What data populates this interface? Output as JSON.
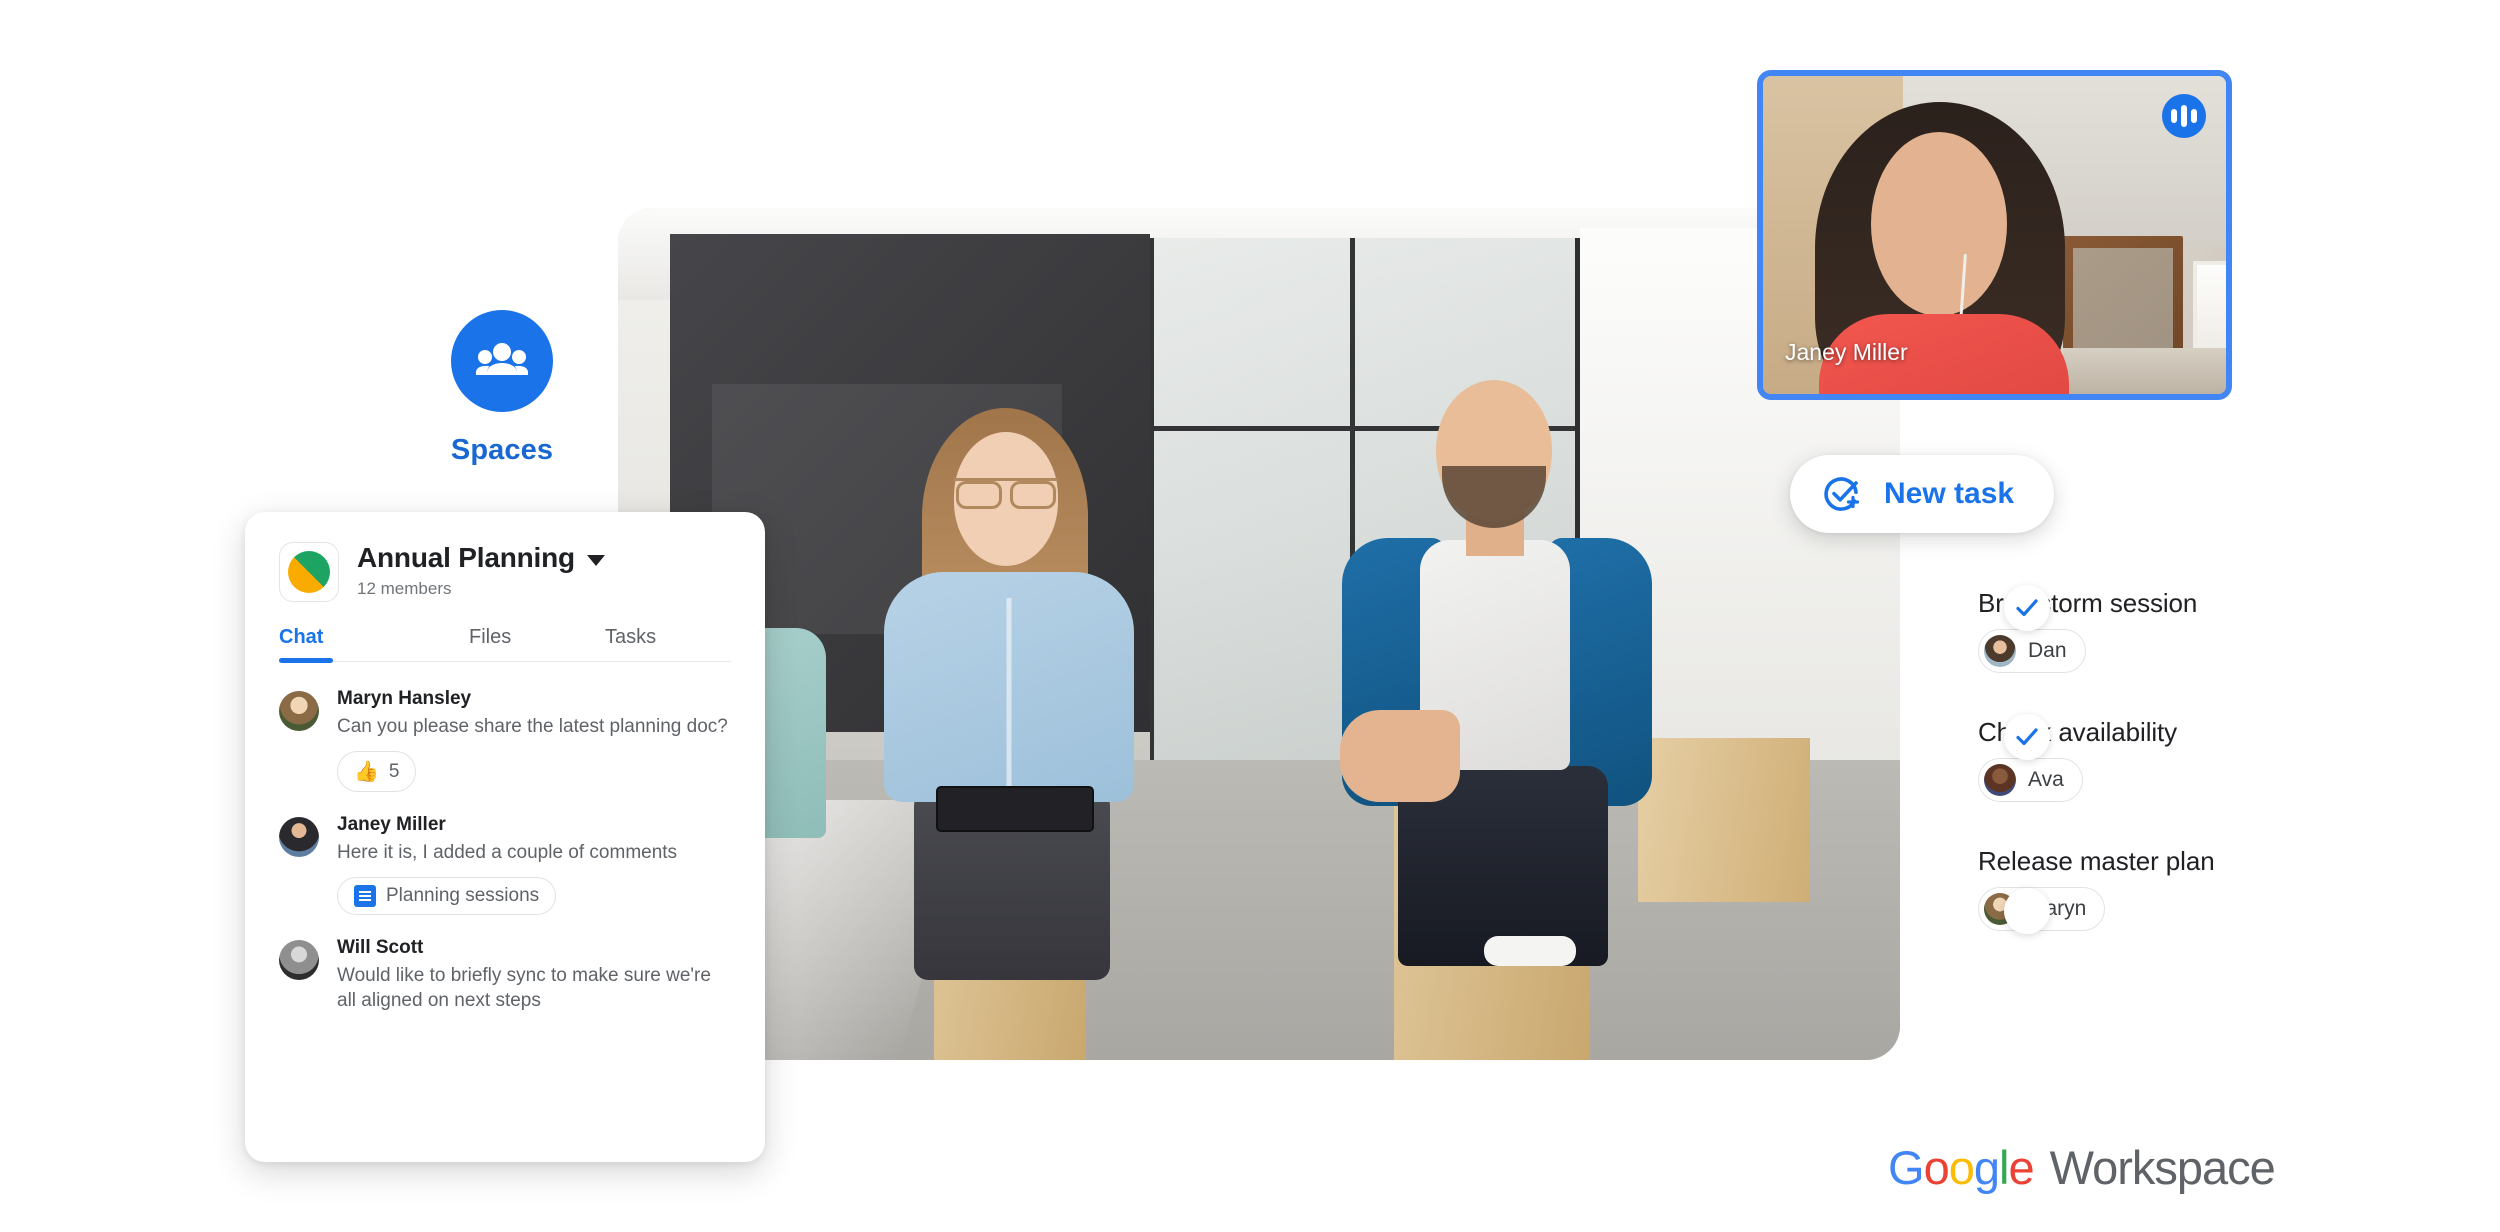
{
  "spaces_nav": {
    "label": "Spaces",
    "icon": "people-group-icon",
    "accent": "#1A73E8",
    "label_color": "#1967D2"
  },
  "chat_card": {
    "space_name": "Annual Planning",
    "members": "12 members",
    "avatar_icon": "space-avatar-green-yellow",
    "avatar_colors": {
      "green": "#1DA462",
      "yellow": "#F9AB00"
    },
    "dropdown_icon": "chevron-down-icon",
    "tabs": [
      {
        "label": "Chat",
        "active": true
      },
      {
        "label": "Files",
        "active": false
      },
      {
        "label": "Tasks",
        "active": false
      }
    ],
    "active_tab_color": "#1A73E8",
    "messages": [
      {
        "author": "Maryn Hansley",
        "text": "Can you please share the latest planning doc?",
        "reaction": {
          "emoji": "👍",
          "count": "5"
        }
      },
      {
        "author": "Janey Miller",
        "text": "Here it is, I added a couple of comments",
        "attachment": {
          "icon": "google-docs-icon",
          "label": "Planning sessions"
        }
      },
      {
        "author": "Will Scott",
        "text": "Would like to briefly sync to make sure we're all aligned on next steps"
      }
    ]
  },
  "pip_video": {
    "participant_name": "Janey Miller",
    "border_color": "#4285F4",
    "audio_badge_icon": "audio-waveform-icon",
    "audio_badge_color": "#1A73E8"
  },
  "new_task_button": {
    "label": "New task",
    "icon": "check-circle-plus-icon",
    "color": "#1A73E8"
  },
  "tasks": [
    {
      "title": "Brainstorm session",
      "assignee": "Dan",
      "checked": false
    },
    {
      "title": "Check availability",
      "assignee": "Ava",
      "checked": true
    },
    {
      "title": "Release master plan",
      "assignee": "Maryn",
      "checked": true
    }
  ],
  "brand": {
    "google": [
      "G",
      "o",
      "o",
      "g",
      "l",
      "e"
    ],
    "workspace": "Workspace",
    "colors": {
      "blue": "#4285F4",
      "red": "#EA4335",
      "yellow": "#FBBC05",
      "green": "#34A853",
      "gray": "#5F6368"
    }
  }
}
